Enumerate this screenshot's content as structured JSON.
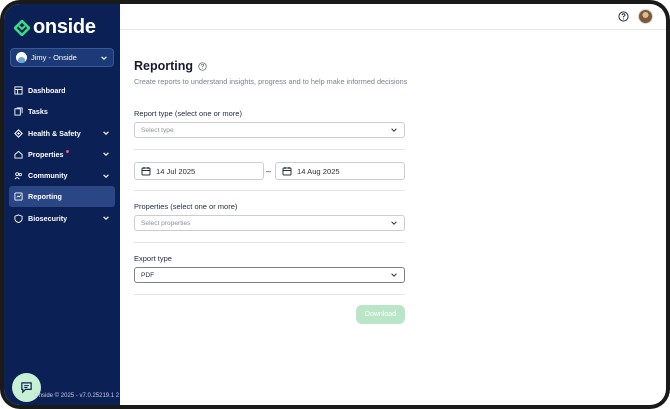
{
  "brand": {
    "name": "onside",
    "accent": "#3ddc84",
    "sidebar_bg": "#0b2155"
  },
  "account": {
    "name": "Jimy - Onside"
  },
  "sidebar": {
    "items": [
      {
        "label": "Dashboard",
        "icon": "dashboard-icon",
        "expandable": false,
        "active": false
      },
      {
        "label": "Tasks",
        "icon": "tasks-icon",
        "expandable": false,
        "active": false
      },
      {
        "label": "Health & Safety",
        "icon": "health-safety-icon",
        "expandable": true,
        "active": false
      },
      {
        "label": "Properties",
        "icon": "properties-icon",
        "expandable": true,
        "active": false,
        "notification": true
      },
      {
        "label": "Community",
        "icon": "community-icon",
        "expandable": true,
        "active": false
      },
      {
        "label": "Reporting",
        "icon": "reporting-icon",
        "expandable": false,
        "active": true
      },
      {
        "label": "Biosecurity",
        "icon": "biosecurity-icon",
        "expandable": true,
        "active": false
      }
    ],
    "footer": "Onside © 2025 - v7.0.25219.1 2"
  },
  "page": {
    "title": "Reporting",
    "subtitle": "Create reports to understand insights, progress and to help make informed decisions"
  },
  "form": {
    "report_type": {
      "label": "Report type (select one or more)",
      "placeholder": "Select type"
    },
    "date_from": "14 Jul 2025",
    "date_separator": "–",
    "date_to": "14 Aug 2025",
    "properties": {
      "label": "Properties (select one or more)",
      "placeholder": "Select properties"
    },
    "export_type": {
      "label": "Export type",
      "value": "PDF"
    },
    "download_label": "Download"
  }
}
